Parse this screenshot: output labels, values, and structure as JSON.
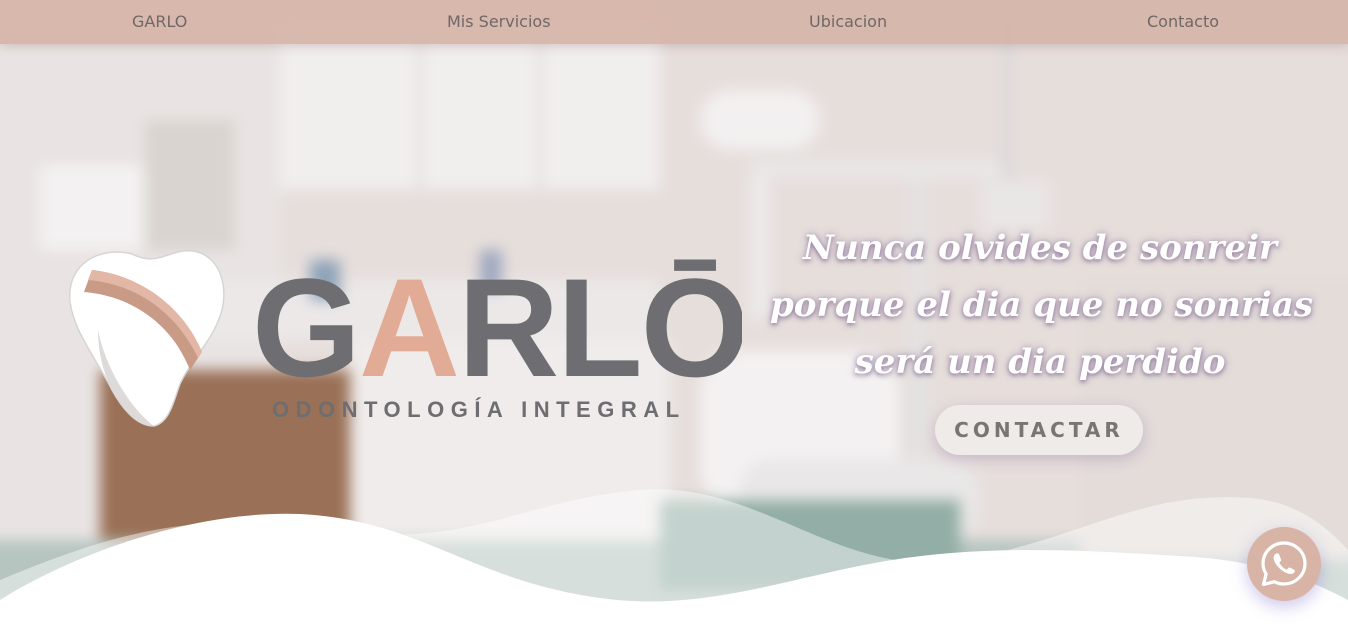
{
  "navbar": {
    "brand": "GARLO",
    "services": "Mis Servicios",
    "location": "Ubicacion",
    "contact": "Contacto"
  },
  "logo": {
    "wordmark_start": "G",
    "wordmark_accent": "A",
    "wordmark_end": "RLŌ",
    "subtitle": "ODONTOLOGÍA INTEGRAL"
  },
  "hero": {
    "tagline_lines": [
      "Nunca olvides de sonreir",
      "porque el dia que no sonrias",
      "será un dia perdido"
    ],
    "cta_label": "CONTACTAR"
  },
  "colors": {
    "navbar_bg": "#d6b4a8",
    "logo_gray": "#6e6e72",
    "logo_rose": "#e2ab96",
    "cta_text": "#7a7472",
    "whatsapp_bg": "#d8b4a6"
  },
  "icons": {
    "whatsapp": "whatsapp-icon",
    "tooth": "tooth-logo-icon"
  }
}
